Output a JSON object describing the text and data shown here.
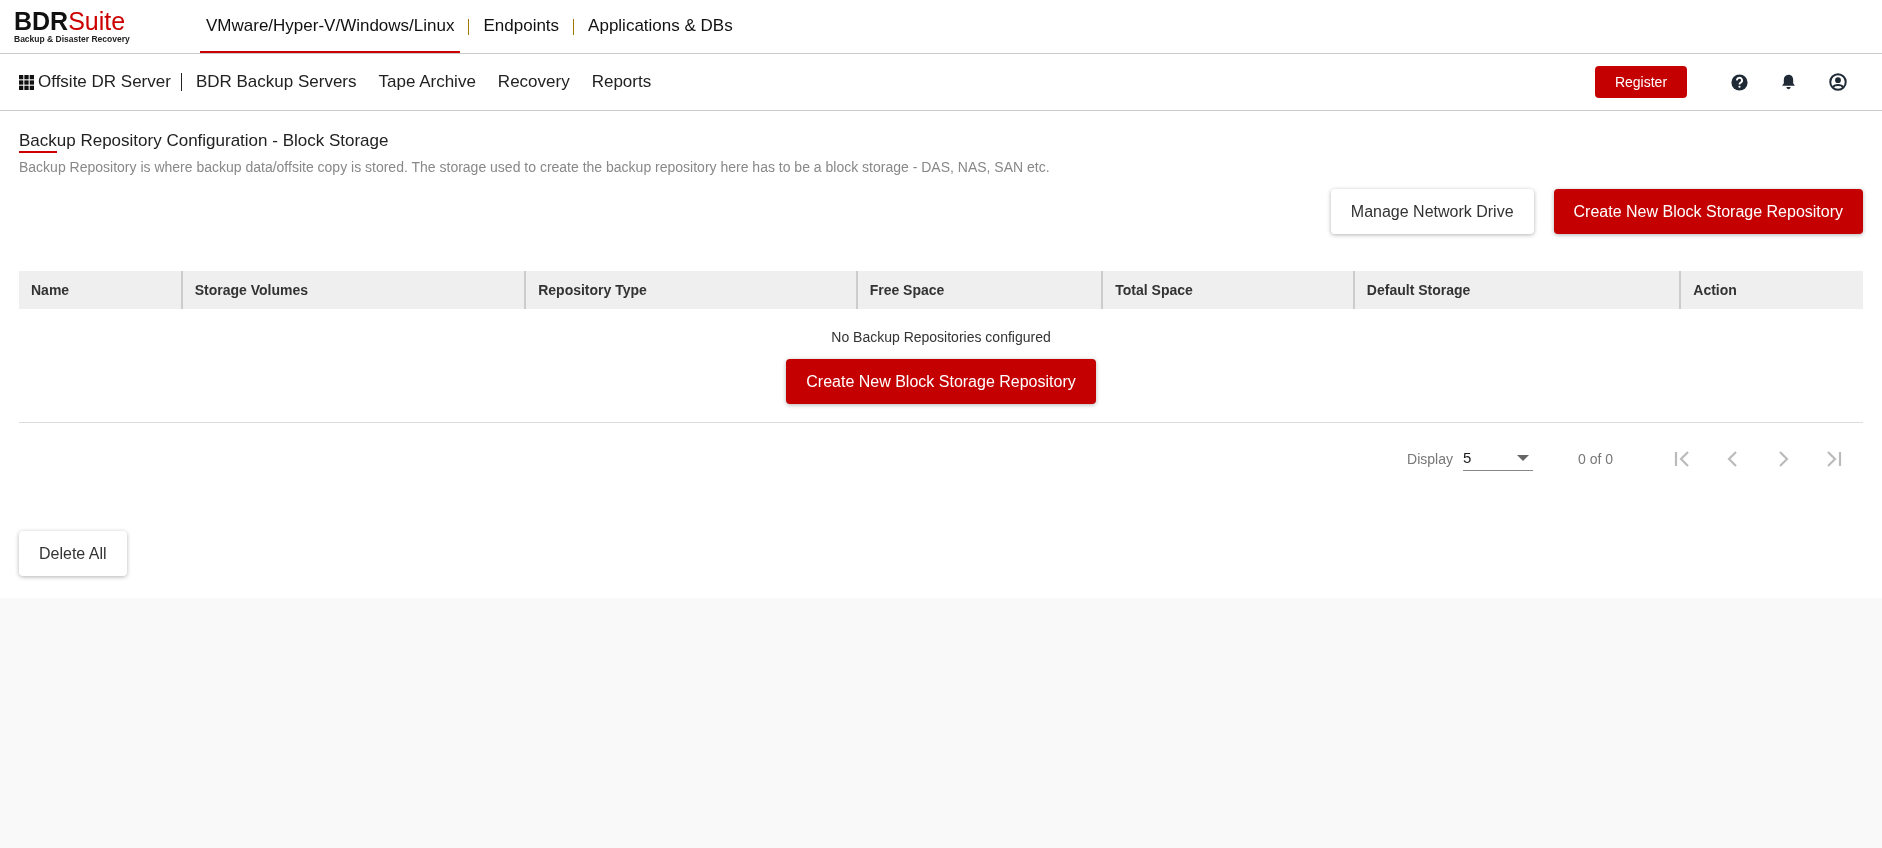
{
  "logo": {
    "prefix": "BDR",
    "suffix": "Suite",
    "tagline": "Backup & Disaster Recovery"
  },
  "product_tabs": [
    {
      "label": "VMware/Hyper-V/Windows/Linux",
      "selected": true
    },
    {
      "label": "Endpoints",
      "selected": false
    },
    {
      "label": "Applications & DBs",
      "selected": false
    }
  ],
  "nav": {
    "home": "Offsite DR Server",
    "items": [
      "BDR Backup Servers",
      "Tape Archive",
      "Recovery",
      "Reports"
    ],
    "register": "Register"
  },
  "page": {
    "title": "Backup Repository Configuration - Block Storage",
    "description": "Backup Repository is where backup data/offsite copy is stored. The storage used to create the backup repository here has to be a block storage - DAS, NAS, SAN etc.",
    "actions": [
      {
        "label": "Manage Network Drive",
        "kind": "secondary"
      },
      {
        "label": "Create New Block Storage Repository",
        "kind": "primary"
      }
    ]
  },
  "table": {
    "columns": [
      "Name",
      "Storage Volumes",
      "Repository Type",
      "Free Space",
      "Total Space",
      "Default Storage",
      "Action"
    ],
    "empty_message": "No Backup Repositories configured",
    "empty_action": "Create New Block Storage Repository"
  },
  "pagination": {
    "display_label": "Display",
    "page_size": "5",
    "range": "0 of 0"
  },
  "footer_action": "Delete All"
}
